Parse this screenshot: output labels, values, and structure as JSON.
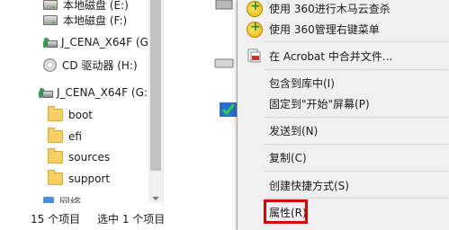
{
  "tree": {
    "items": [
      {
        "label": "本地磁盘 (E:)",
        "icon": "drive-icon"
      },
      {
        "label": "本地磁盘 (F:)",
        "icon": "drive-icon"
      },
      {
        "label": "J_CENA_X64F (G:)",
        "icon": "network-drive-icon"
      },
      {
        "label": "CD 驱动器 (H:)",
        "icon": "cd-drive-icon"
      },
      {
        "label": "J_CENA_X64F (G:)",
        "icon": "network-drive-icon"
      },
      {
        "label": "boot",
        "icon": "folder-icon"
      },
      {
        "label": "efi",
        "icon": "folder-icon"
      },
      {
        "label": "sources",
        "icon": "folder-icon"
      },
      {
        "label": "support",
        "icon": "folder-icon"
      },
      {
        "label": "网络",
        "icon": "network-icon"
      }
    ]
  },
  "status": {
    "item_count": "15 个项目",
    "selection": "选中 1 个项目"
  },
  "context_menu": {
    "items": [
      {
        "label": "使用 360进行木马云查杀",
        "icon": "360-icon"
      },
      {
        "label": "使用 360管理右键菜单",
        "icon": "360-icon"
      },
      {
        "label": "在 Acrobat 中合并文件...",
        "icon": "acrobat-pdf-icon"
      },
      {
        "label": "包含到库中(I)"
      },
      {
        "label": "固定到\"开始\"屏幕(P)"
      },
      {
        "label": "发送到(N)"
      },
      {
        "label": "复制(C)"
      },
      {
        "label": "创建快捷方式(S)"
      },
      {
        "label": "属性(R)"
      }
    ]
  },
  "colors": {
    "highlight": "#e00000",
    "menu_background": "#f0f0f0"
  }
}
